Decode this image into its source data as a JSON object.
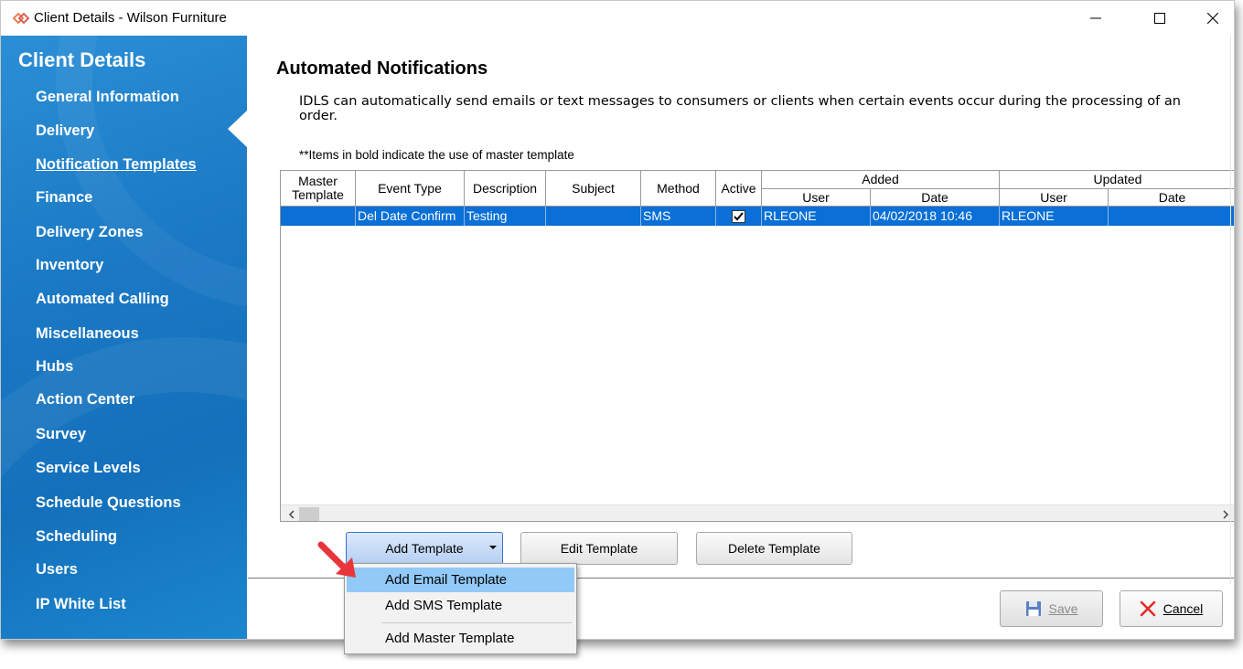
{
  "window": {
    "title": "Client Details - Wilson Furniture"
  },
  "sidebar": {
    "title": "Client Details",
    "items": [
      {
        "label": "General Information"
      },
      {
        "label": "Delivery"
      },
      {
        "label": "Notification Templates",
        "active": true
      },
      {
        "label": "Finance"
      },
      {
        "label": "Delivery Zones"
      },
      {
        "label": "Inventory"
      },
      {
        "label": "Automated Calling"
      },
      {
        "label": "Miscellaneous"
      },
      {
        "label": "Hubs"
      },
      {
        "label": "Action Center"
      },
      {
        "label": "Survey"
      },
      {
        "label": "Service Levels"
      },
      {
        "label": "Schedule Questions"
      },
      {
        "label": "Scheduling"
      },
      {
        "label": "Users"
      },
      {
        "label": "IP White List"
      }
    ]
  },
  "main": {
    "title": "Automated Notifications",
    "description": "IDLS can automatically send emails or text messages to consumers or clients when certain events occur during the processing of an order.",
    "note": "**Items in bold indicate the use of master template"
  },
  "grid": {
    "headers": {
      "master_template": "Master Template",
      "event_type": "Event Type",
      "description": "Description",
      "subject": "Subject",
      "method": "Method",
      "active": "Active",
      "added": "Added",
      "updated": "Updated",
      "added_user": "User",
      "added_date": "Date",
      "updated_user": "User",
      "updated_date": "Date"
    },
    "rows": [
      {
        "master_template": "",
        "event_type": "Del Date Confirm",
        "description": "Testing",
        "subject": "",
        "method": "SMS",
        "active": true,
        "added_user": "RLEONE",
        "added_date": "04/02/2018 10:46",
        "updated_user": "RLEONE",
        "updated_date": ""
      }
    ]
  },
  "buttons": {
    "add_template": "Add Template",
    "edit_template": "Edit Template",
    "delete_template": "Delete Template",
    "save": "Save",
    "cancel": "Cancel"
  },
  "add_menu": {
    "items": [
      {
        "label": "Add Email Template",
        "highlighted": true
      },
      {
        "label": "Add SMS Template"
      },
      {
        "label": "Add Master Template"
      }
    ]
  },
  "colors": {
    "sidebar_blue": "#1a78c4",
    "selection_blue": "#0a6fd6",
    "menu_highlight": "#91c9f7",
    "annotation_arrow": "#e8353b"
  },
  "icons": {
    "app": "app-logo-icon",
    "minimize": "minimize-icon",
    "maximize": "maximize-icon",
    "close": "close-icon",
    "save": "floppy-disk-icon",
    "cancel": "red-x-icon",
    "dropdown": "chevron-down-icon",
    "scroll_left": "chevron-left-icon",
    "scroll_right": "chevron-right-icon",
    "checkbox": "checkmark-icon",
    "annotation": "red-arrow-icon"
  }
}
